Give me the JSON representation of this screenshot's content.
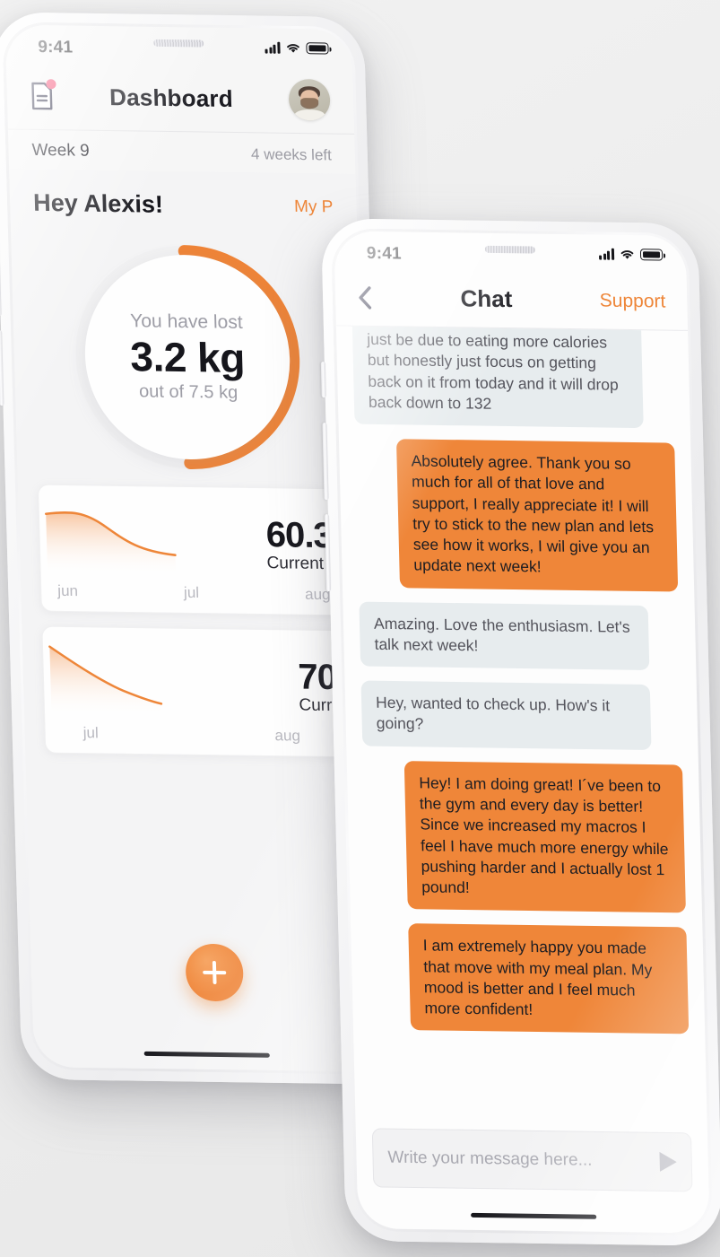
{
  "phone_dashboard": {
    "status_bar": {
      "time": "9:41",
      "signal_icon": "cellular-bars-icon",
      "wifi_icon": "wifi-icon",
      "battery_icon": "battery-icon"
    },
    "nav": {
      "notes_icon": "document-note-icon",
      "notification_badge": "notification-dot",
      "title": "Dashboard",
      "avatar": "user-avatar"
    },
    "week_row": {
      "week_label": "Week 9",
      "weeks_left": "4 weeks left"
    },
    "greeting": "Hey Alexis!",
    "my_plan_link": "My P",
    "progress_ring": {
      "caption": "You have lost",
      "value": "3.2 kg",
      "subcaption": "out of 7.5 kg",
      "accent_color": "#ef8437",
      "track_color": "#f1f1f2",
      "percent": 43
    },
    "cards": [
      {
        "value": "60.3",
        "label": "Current",
        "months": [
          "jun",
          "jul",
          "aug"
        ]
      },
      {
        "value": "70",
        "label": "Curr",
        "months": [
          "jul",
          "aug"
        ]
      }
    ],
    "fab_label": "add-plus"
  },
  "phone_chat": {
    "status_bar": {
      "time": "9:41",
      "signal_icon": "cellular-bars-icon",
      "wifi_icon": "wifi-icon",
      "battery_icon": "battery-icon"
    },
    "nav": {
      "back_icon": "chevron-left-icon",
      "title": "Chat",
      "support_link": "Support"
    },
    "messages": [
      {
        "from": "them",
        "text": "just be due to eating more calories but honestly just focus on getting back on it from today and it will drop back down to 132"
      },
      {
        "from": "me",
        "text": "Absolutely agree. Thank you so much for all of that love and support, I really appreciate it! I will try to stick to the new plan and lets see how it works, I wil give you an update next week!"
      },
      {
        "from": "them",
        "text": "Amazing. Love the enthusiasm. Let's talk next week!"
      },
      {
        "from": "them",
        "text": "Hey, wanted to check up. How's it going?"
      },
      {
        "from": "me",
        "text": "Hey! I am doing great! I´ve been to the gym and every day is better! Since we increased my macros I feel I have much more energy while pushing harder and I actually lost 1 pound!"
      },
      {
        "from": "me",
        "text": "I am extremely happy you made that move with my meal plan. My mood is better and I feel much more confident!"
      }
    ],
    "composer": {
      "placeholder": "Write your message here...",
      "value": "",
      "send_icon": "send-arrow-icon"
    }
  },
  "colors": {
    "accent": "#ef8437",
    "them_bubble": "#e7ecee",
    "badge": "#f4436c",
    "text_dark": "#16161c"
  }
}
